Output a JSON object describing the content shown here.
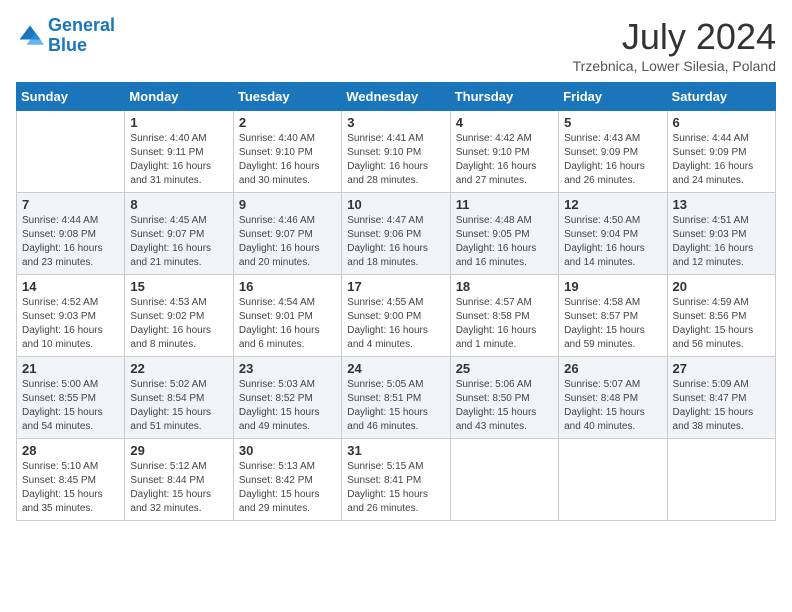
{
  "header": {
    "logo_general": "General",
    "logo_blue": "Blue",
    "month_title": "July 2024",
    "location": "Trzebnica, Lower Silesia, Poland"
  },
  "days_of_week": [
    "Sunday",
    "Monday",
    "Tuesday",
    "Wednesday",
    "Thursday",
    "Friday",
    "Saturday"
  ],
  "weeks": [
    [
      {
        "day": "",
        "info": ""
      },
      {
        "day": "1",
        "info": "Sunrise: 4:40 AM\nSunset: 9:11 PM\nDaylight: 16 hours\nand 31 minutes."
      },
      {
        "day": "2",
        "info": "Sunrise: 4:40 AM\nSunset: 9:10 PM\nDaylight: 16 hours\nand 30 minutes."
      },
      {
        "day": "3",
        "info": "Sunrise: 4:41 AM\nSunset: 9:10 PM\nDaylight: 16 hours\nand 28 minutes."
      },
      {
        "day": "4",
        "info": "Sunrise: 4:42 AM\nSunset: 9:10 PM\nDaylight: 16 hours\nand 27 minutes."
      },
      {
        "day": "5",
        "info": "Sunrise: 4:43 AM\nSunset: 9:09 PM\nDaylight: 16 hours\nand 26 minutes."
      },
      {
        "day": "6",
        "info": "Sunrise: 4:44 AM\nSunset: 9:09 PM\nDaylight: 16 hours\nand 24 minutes."
      }
    ],
    [
      {
        "day": "7",
        "info": "Sunrise: 4:44 AM\nSunset: 9:08 PM\nDaylight: 16 hours\nand 23 minutes."
      },
      {
        "day": "8",
        "info": "Sunrise: 4:45 AM\nSunset: 9:07 PM\nDaylight: 16 hours\nand 21 minutes."
      },
      {
        "day": "9",
        "info": "Sunrise: 4:46 AM\nSunset: 9:07 PM\nDaylight: 16 hours\nand 20 minutes."
      },
      {
        "day": "10",
        "info": "Sunrise: 4:47 AM\nSunset: 9:06 PM\nDaylight: 16 hours\nand 18 minutes."
      },
      {
        "day": "11",
        "info": "Sunrise: 4:48 AM\nSunset: 9:05 PM\nDaylight: 16 hours\nand 16 minutes."
      },
      {
        "day": "12",
        "info": "Sunrise: 4:50 AM\nSunset: 9:04 PM\nDaylight: 16 hours\nand 14 minutes."
      },
      {
        "day": "13",
        "info": "Sunrise: 4:51 AM\nSunset: 9:03 PM\nDaylight: 16 hours\nand 12 minutes."
      }
    ],
    [
      {
        "day": "14",
        "info": "Sunrise: 4:52 AM\nSunset: 9:03 PM\nDaylight: 16 hours\nand 10 minutes."
      },
      {
        "day": "15",
        "info": "Sunrise: 4:53 AM\nSunset: 9:02 PM\nDaylight: 16 hours\nand 8 minutes."
      },
      {
        "day": "16",
        "info": "Sunrise: 4:54 AM\nSunset: 9:01 PM\nDaylight: 16 hours\nand 6 minutes."
      },
      {
        "day": "17",
        "info": "Sunrise: 4:55 AM\nSunset: 9:00 PM\nDaylight: 16 hours\nand 4 minutes."
      },
      {
        "day": "18",
        "info": "Sunrise: 4:57 AM\nSunset: 8:58 PM\nDaylight: 16 hours\nand 1 minute."
      },
      {
        "day": "19",
        "info": "Sunrise: 4:58 AM\nSunset: 8:57 PM\nDaylight: 15 hours\nand 59 minutes."
      },
      {
        "day": "20",
        "info": "Sunrise: 4:59 AM\nSunset: 8:56 PM\nDaylight: 15 hours\nand 56 minutes."
      }
    ],
    [
      {
        "day": "21",
        "info": "Sunrise: 5:00 AM\nSunset: 8:55 PM\nDaylight: 15 hours\nand 54 minutes."
      },
      {
        "day": "22",
        "info": "Sunrise: 5:02 AM\nSunset: 8:54 PM\nDaylight: 15 hours\nand 51 minutes."
      },
      {
        "day": "23",
        "info": "Sunrise: 5:03 AM\nSunset: 8:52 PM\nDaylight: 15 hours\nand 49 minutes."
      },
      {
        "day": "24",
        "info": "Sunrise: 5:05 AM\nSunset: 8:51 PM\nDaylight: 15 hours\nand 46 minutes."
      },
      {
        "day": "25",
        "info": "Sunrise: 5:06 AM\nSunset: 8:50 PM\nDaylight: 15 hours\nand 43 minutes."
      },
      {
        "day": "26",
        "info": "Sunrise: 5:07 AM\nSunset: 8:48 PM\nDaylight: 15 hours\nand 40 minutes."
      },
      {
        "day": "27",
        "info": "Sunrise: 5:09 AM\nSunset: 8:47 PM\nDaylight: 15 hours\nand 38 minutes."
      }
    ],
    [
      {
        "day": "28",
        "info": "Sunrise: 5:10 AM\nSunset: 8:45 PM\nDaylight: 15 hours\nand 35 minutes."
      },
      {
        "day": "29",
        "info": "Sunrise: 5:12 AM\nSunset: 8:44 PM\nDaylight: 15 hours\nand 32 minutes."
      },
      {
        "day": "30",
        "info": "Sunrise: 5:13 AM\nSunset: 8:42 PM\nDaylight: 15 hours\nand 29 minutes."
      },
      {
        "day": "31",
        "info": "Sunrise: 5:15 AM\nSunset: 8:41 PM\nDaylight: 15 hours\nand 26 minutes."
      },
      {
        "day": "",
        "info": ""
      },
      {
        "day": "",
        "info": ""
      },
      {
        "day": "",
        "info": ""
      }
    ]
  ]
}
